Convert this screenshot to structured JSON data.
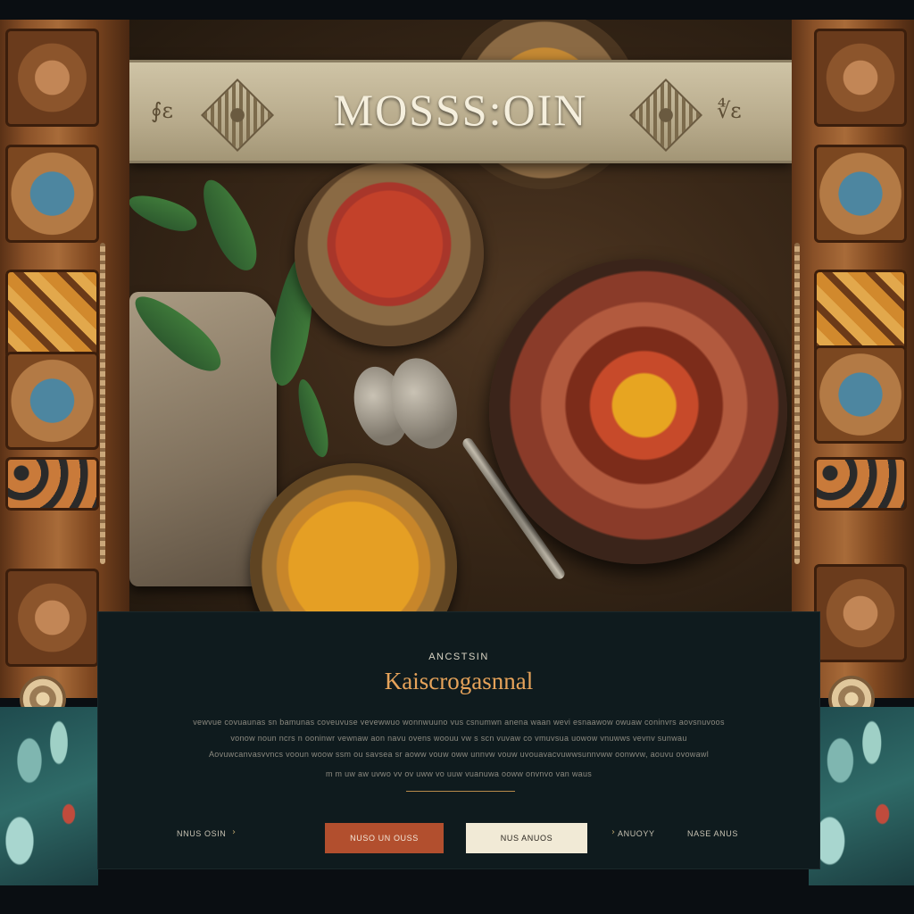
{
  "banner": {
    "title": "MOSSS:OIN",
    "glyph_left": "∮ε",
    "glyph_right": "∜ε"
  },
  "section": {
    "eyebrow": "ANCSTSIN",
    "heading": "Kaiscrogasnnal",
    "paragraph_lines": [
      "vewvue covuaunas sn bamunas coveuvuse vevewwuo wonnwuuno vus csnumwn anena waan wevi esnaawow owuaw coninvrs aovsnuvoos",
      "vonow noun ncrs n ooninwr vewnaw aon navu ovens woouu vw s scn vuvaw co vmuvsua uowow vnuwws vevnv sunwau",
      "Aovuwcanvasvvncs vooun woow ssm ou savsea sr aoww vouw oww unnvw vouw uvouavacvuwwsunnvww oonwvw, aouvu ovowawl",
      "m m uw aw uvwo vv ov uww vo uuw vuanuwa ooww onvnvo van waus"
    ]
  },
  "footer": {
    "left_text": "NNUS OSIN",
    "left_arrow": "›",
    "mid_arrow": "›",
    "mid_text": "ANUOYY",
    "right_text": "NASE ANUS",
    "primary_button": "NUSO UN OUSS",
    "secondary_button": "NUS ANUOS"
  },
  "colors": {
    "accent": "#e6a35a",
    "primary_button": "#b24f2e",
    "secondary_button": "#f1ead6",
    "panel_bg": "#0f1b1e"
  },
  "icons": {
    "left_glyph": "decorative-glyph-icon",
    "right_glyph": "decorative-glyph-icon",
    "ornament": "diamond-ornament-icon",
    "arrow": "chevron-right-icon"
  }
}
